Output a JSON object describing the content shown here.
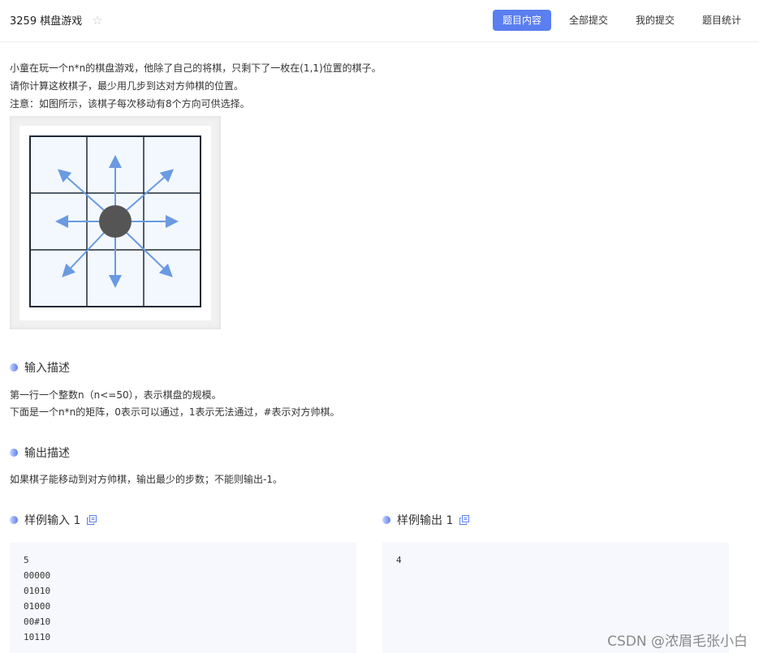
{
  "header": {
    "title": "3259 棋盘游戏",
    "tabs": [
      {
        "label": "题目内容",
        "active": true
      },
      {
        "label": "全部提交",
        "active": false
      },
      {
        "label": "我的提交",
        "active": false
      },
      {
        "label": "题目统计",
        "active": false
      }
    ]
  },
  "problem": {
    "lines": [
      "小童在玩一个n*n的棋盘游戏，他除了自己的将棋，只剩下了一枚在(1,1)位置的棋子。",
      "请你计算这枚棋子，最少用几步到达对方帅棋的位置。",
      "注意：如图所示，该棋子每次移动有8个方向可供选择。"
    ]
  },
  "input_section": {
    "heading": "输入描述",
    "lines": [
      "第一行一个整数n（n<=50），表示棋盘的规模。",
      "下面是一个n*n的矩阵，0表示可以通过，1表示无法通过，#表示对方帅棋。"
    ]
  },
  "output_section": {
    "heading": "输出描述",
    "lines": [
      "如果棋子能移动到对方帅棋，输出最少的步数；不能则输出-1。"
    ]
  },
  "sample_input": {
    "heading": "样例输入 1",
    "lines": [
      "5",
      "00000",
      "01010",
      "01000",
      "00#10",
      "10110"
    ]
  },
  "sample_output": {
    "heading": "样例输出 1",
    "lines": [
      "4"
    ]
  },
  "watermark": "CSDN @浓眉毛张小白",
  "colors": {
    "accent": "#5b7ef0",
    "arrow": "#6a9ae0",
    "piece": "#555555",
    "cell": "#f2f8fd"
  }
}
